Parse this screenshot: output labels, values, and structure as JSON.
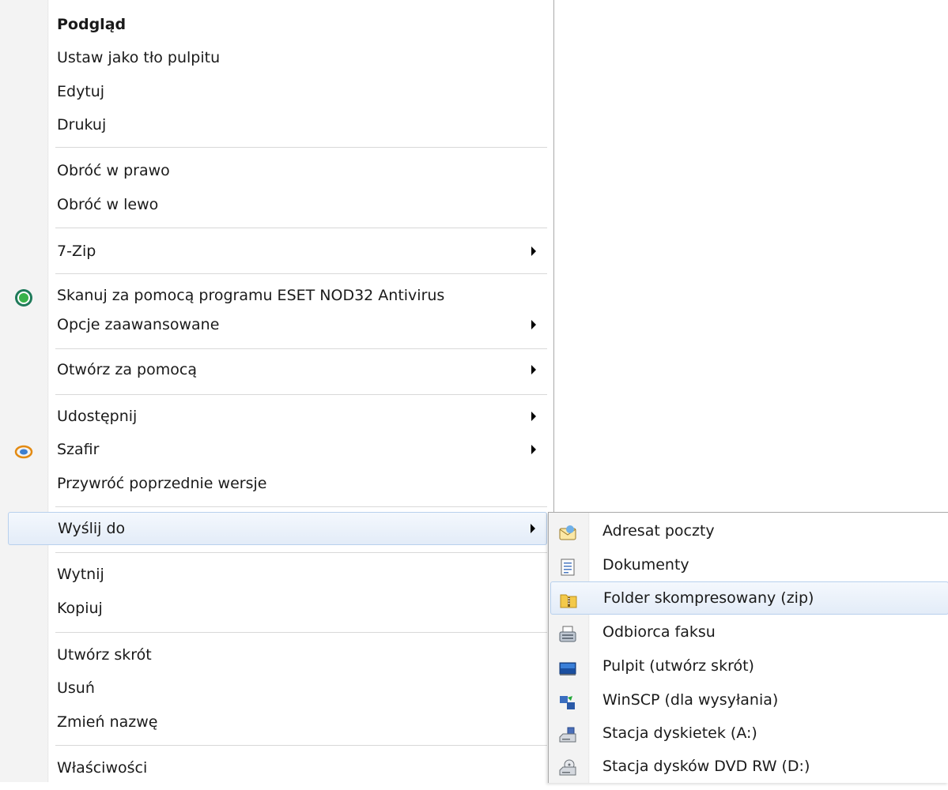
{
  "main_menu": {
    "preview": "Podgląd",
    "set_as_wallpaper": "Ustaw jako tło pulpitu",
    "edit": "Edytuj",
    "print": "Drukuj",
    "rotate_right": "Obróć w prawo",
    "rotate_left": "Obróć w lewo",
    "seven_zip": "7-Zip",
    "scan_eset": "Skanuj za pomocą programu ESET NOD32 Antivirus",
    "advanced_options": "Opcje zaawansowane",
    "open_with": "Otwórz za pomocą",
    "share": "Udostępnij",
    "szafir": "Szafir",
    "restore_versions": "Przywróć poprzednie wersje",
    "send_to": "Wyślij do",
    "cut": "Wytnij",
    "copy": "Kopiuj",
    "create_shortcut": "Utwórz skrót",
    "delete": "Usuń",
    "rename": "Zmień nazwę",
    "properties": "Właściwości"
  },
  "send_to_menu": {
    "mail_recipient": "Adresat poczty",
    "documents": "Dokumenty",
    "compressed_folder": "Folder skompresowany (zip)",
    "fax_recipient": "Odbiorca faksu",
    "desktop_shortcut": "Pulpit (utwórz skrót)",
    "winscp": "WinSCP (dla wysyłania)",
    "floppy_drive": "Stacja dyskietek (A:)",
    "dvd_drive": "Stacja dysków DVD RW (D:)"
  },
  "icons": {
    "eset": "eset-icon",
    "szafir": "szafir-icon",
    "mail": "mail-icon",
    "documents": "document-icon",
    "zip": "zip-folder-icon",
    "fax": "fax-icon",
    "desktop": "desktop-icon",
    "winscp": "winscp-icon",
    "floppy": "floppy-drive-icon",
    "dvd": "dvd-drive-icon"
  },
  "colors": {
    "hover_border": "#b8d0ed",
    "hover_fill": "#e3ecf8",
    "gutter": "#f3f3f3"
  }
}
